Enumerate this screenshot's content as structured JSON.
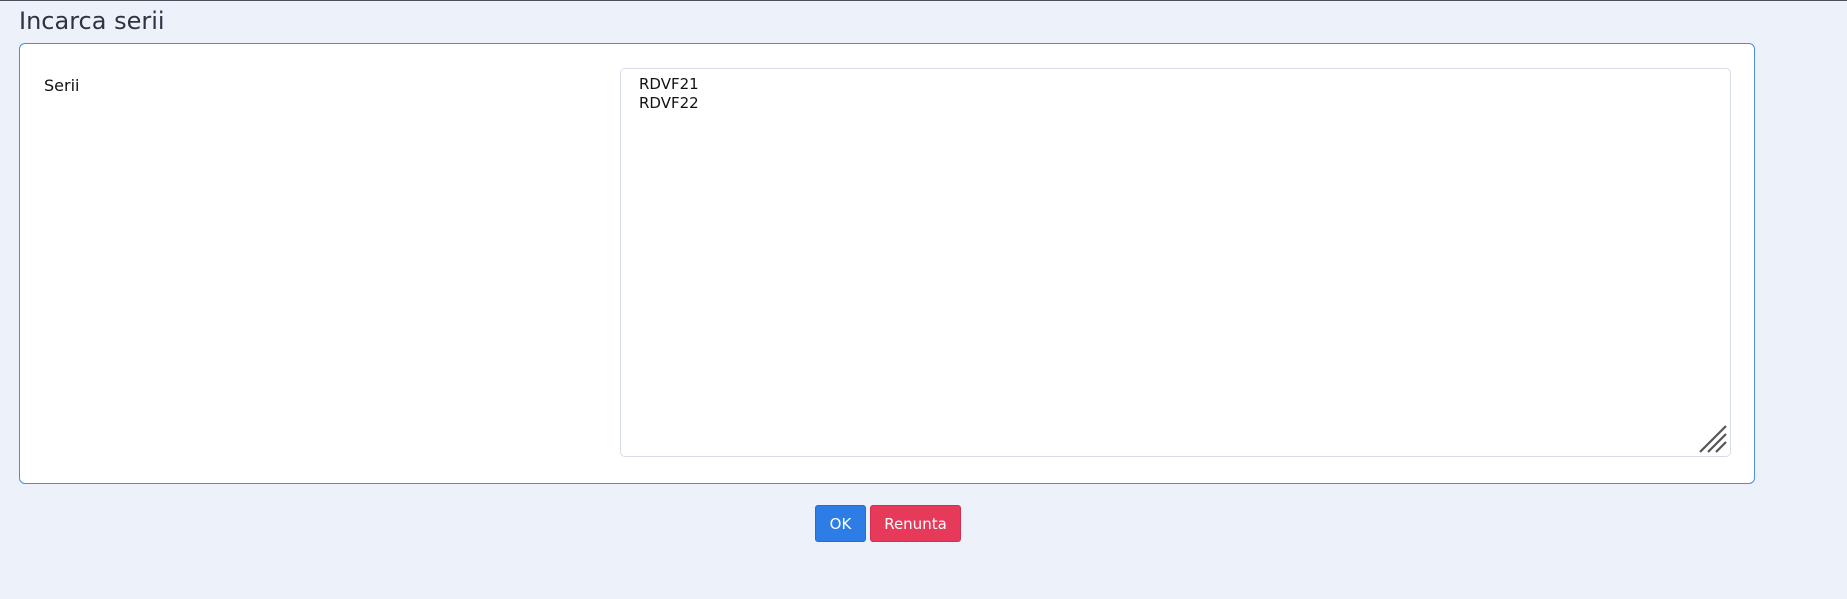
{
  "header": {
    "title": "Incarca serii"
  },
  "form": {
    "series_label": "Serii",
    "series_value": "RDVF21\nRDVF22",
    "resize_handle_icon": "resize-handle-icon"
  },
  "actions": {
    "ok_label": "OK",
    "cancel_label": "Renunta"
  },
  "colors": {
    "page_background": "#edf1f9",
    "panel_border": "#4f8ae4",
    "primary": "#2e7de6",
    "danger": "#e7395a"
  }
}
